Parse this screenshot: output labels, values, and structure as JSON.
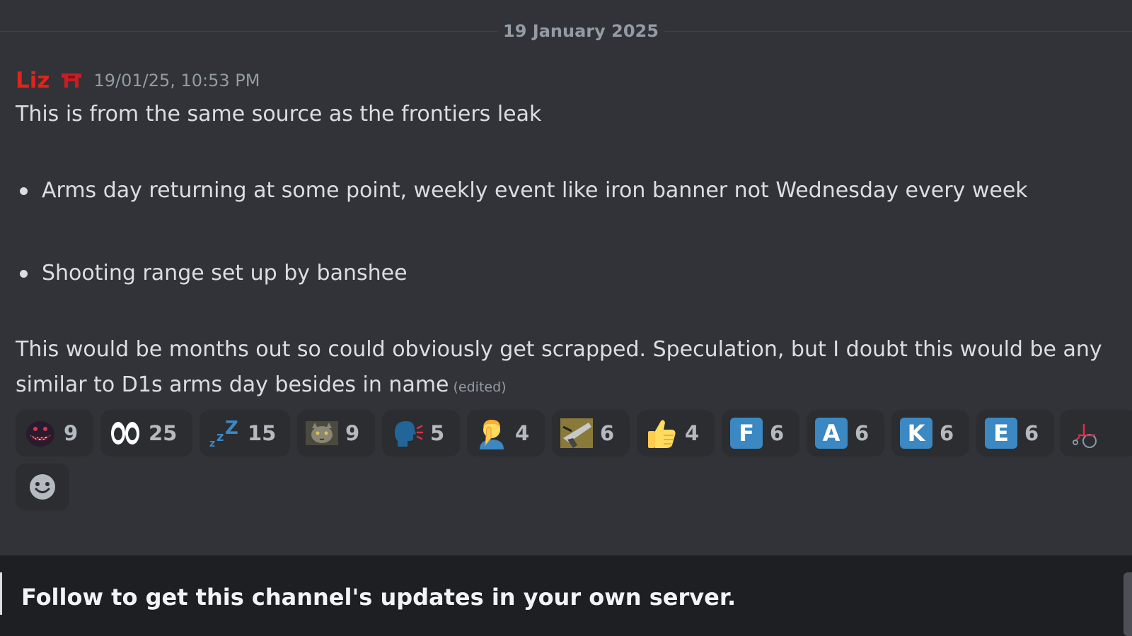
{
  "divider": {
    "date": "19 January 2025"
  },
  "message": {
    "author": "Liz",
    "timestamp": "19/01/25, 10:53 PM",
    "intro": "This is from the same source as the frontiers leak",
    "bullets": [
      "Arms day returning at some point, weekly event like iron banner not Wednesday every week",
      "Shooting range set up by banshee"
    ],
    "body_line1": "This would be months out so could obviously get scrapped. Speculation, but I doubt this would be any",
    "body_line2": "similar to D1s arms day besides in name",
    "edited": "(edited)"
  },
  "reactions": [
    {
      "icon": "creature-face-emoji",
      "count": "9"
    },
    {
      "icon": "eyes-emoji",
      "count": "25"
    },
    {
      "icon": "zzz-emoji",
      "count": "15"
    },
    {
      "icon": "cat-photo-emoji",
      "count": "9"
    },
    {
      "icon": "speaking-head-emoji",
      "count": "5"
    },
    {
      "icon": "facepalm-emoji",
      "count": "4"
    },
    {
      "icon": "weapon-emoji",
      "count": "6"
    },
    {
      "icon": "thumbs-up-emoji",
      "count": "4"
    },
    {
      "icon": "letter-f-emoji",
      "letter": "F",
      "count": "6"
    },
    {
      "icon": "letter-a-emoji",
      "letter": "A",
      "count": "6"
    },
    {
      "icon": "letter-k-emoji",
      "letter": "K",
      "count": "6"
    },
    {
      "icon": "letter-e-emoji",
      "letter": "E",
      "count": "6"
    },
    {
      "icon": "wheelchair-emoji",
      "count": ""
    }
  ],
  "footer": {
    "text": "Follow to get this channel's updates in your own server."
  },
  "colors": {
    "background": "#313338",
    "author": "#e0241b",
    "letter_tile": "#3b88c3",
    "footer": "#1e1f22"
  }
}
